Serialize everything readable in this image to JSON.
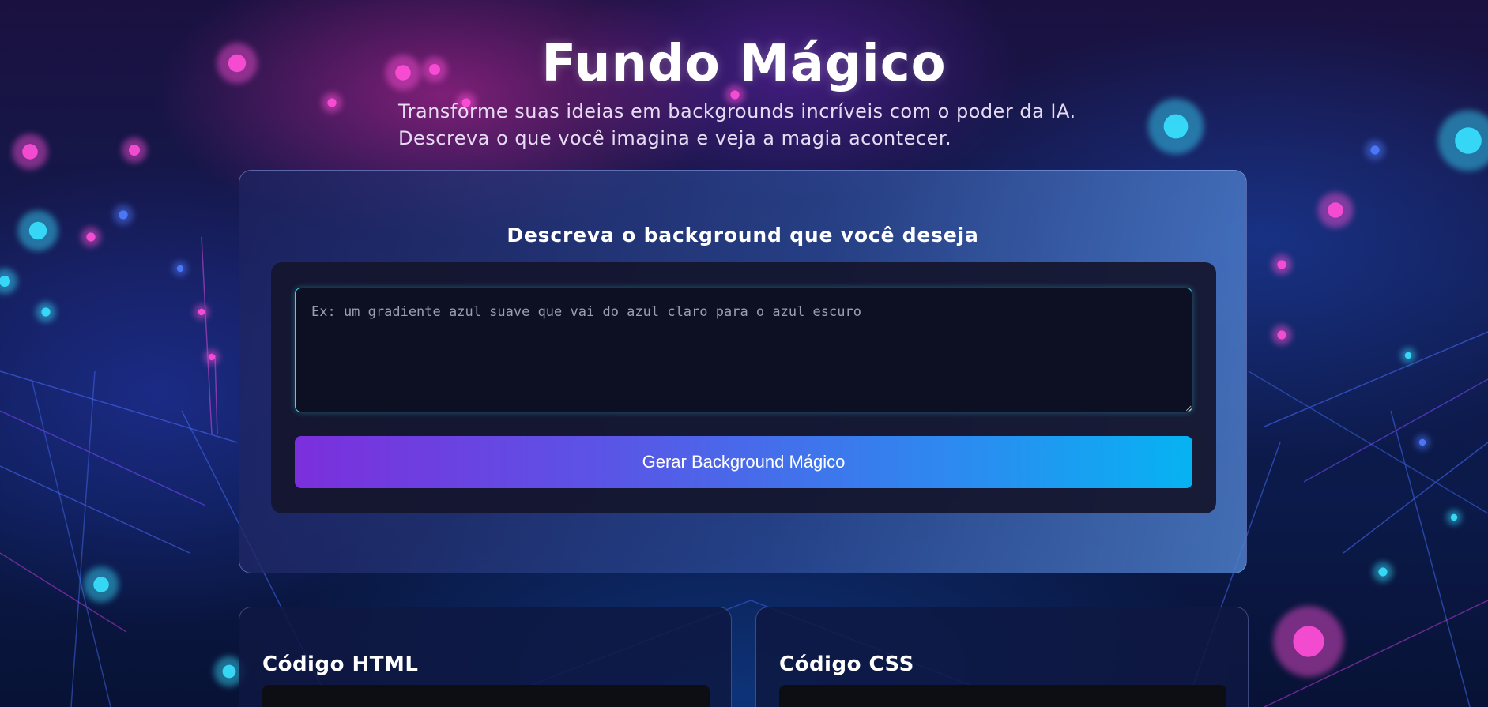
{
  "header": {
    "title": "Fundo Mágico",
    "subtitle": "Transforme suas ideias em backgrounds incríveis com o poder da IA. Descreva o que você imagina e veja a magia acontecer."
  },
  "generator": {
    "heading": "Descreva o background que você deseja",
    "textarea": {
      "value": "",
      "placeholder": "Ex: um gradiente azul suave que vai do azul claro para o azul escuro"
    },
    "button_label": "Gerar Background Mágico"
  },
  "output": {
    "html_title": "Código HTML",
    "css_title": "Código CSS",
    "html_code": "",
    "css_code": ""
  },
  "colors": {
    "accent_cyan": "#38d9e6",
    "button_gradient_start": "#7b2fdc",
    "button_gradient_end": "#06b3f2",
    "glow_pink": "#ff4fd8",
    "glow_cyan": "#39e1ff"
  }
}
